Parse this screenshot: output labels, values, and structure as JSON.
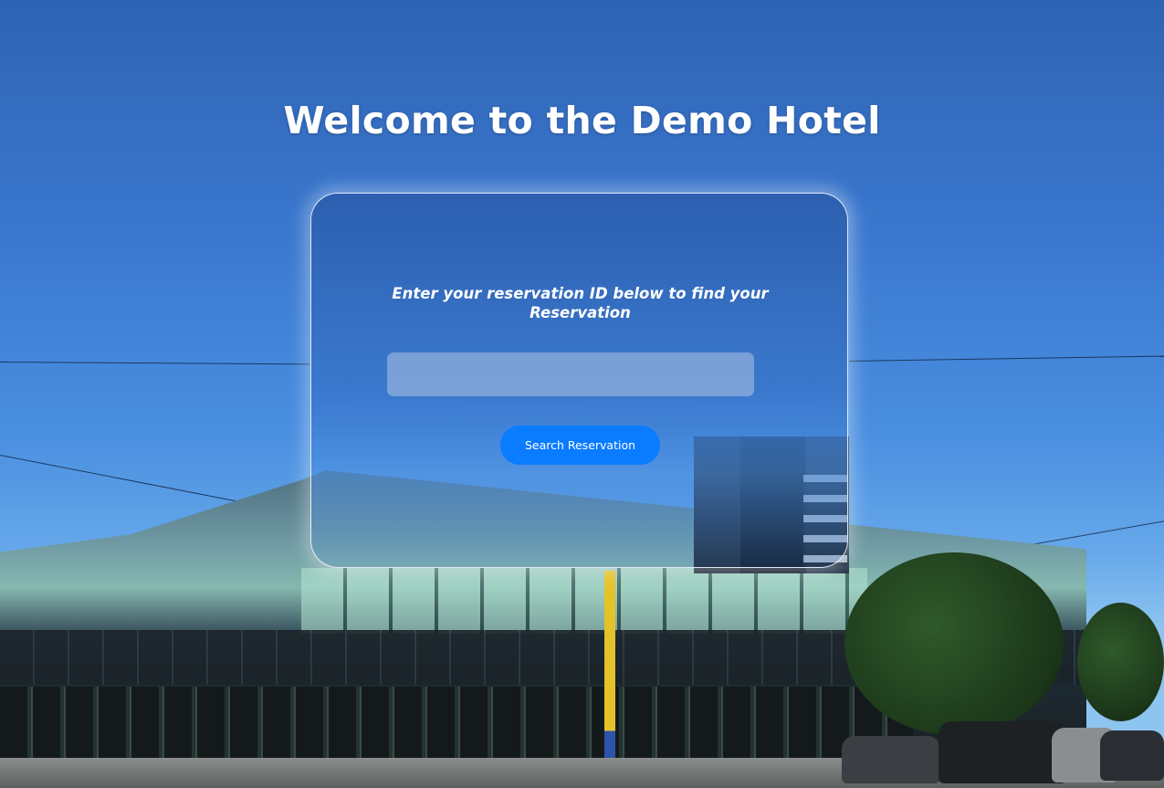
{
  "page": {
    "title": "Welcome to the Demo Hotel"
  },
  "reservation_card": {
    "prompt": "Enter your reservation ID below to find your Reservation",
    "input_value": "",
    "input_placeholder": "",
    "search_button_label": "Search Reservation"
  },
  "colors": {
    "accent": "#0a7cff",
    "title_text": "#ffffff"
  }
}
